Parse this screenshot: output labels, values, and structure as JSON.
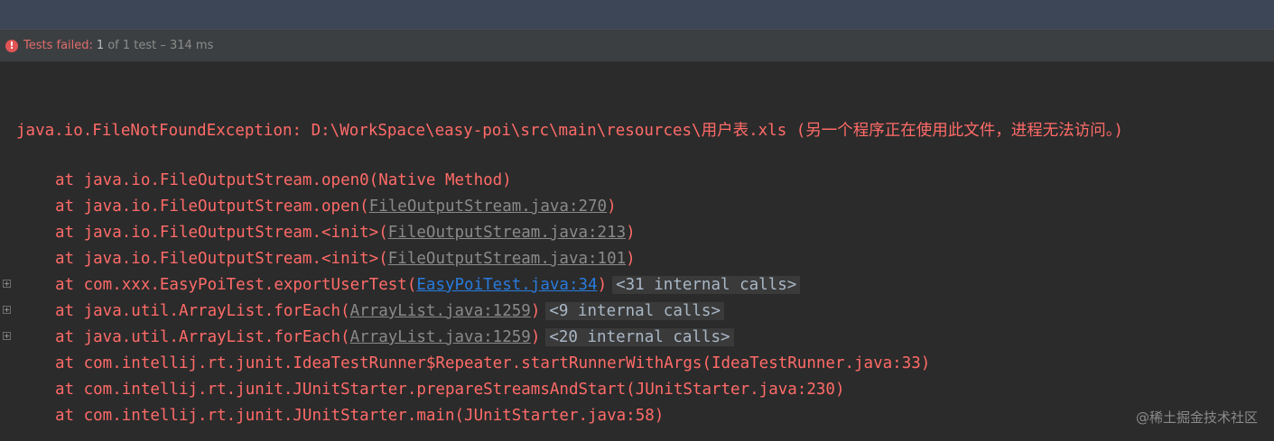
{
  "status": {
    "failed_label": "Tests failed:",
    "count": "1",
    "rest": "of 1 test – 314 ms"
  },
  "console": {
    "exception": "java.io.FileNotFoundException: D:\\WorkSpace\\easy-poi\\src\\main\\resources\\用户表.xls (另一个程序正在使用此文件，进程无法访问。)",
    "trace": [
      {
        "prefix": "at java.io.FileOutputStream.open0(Native Method)",
        "link": "",
        "suffix": "",
        "internal": ""
      },
      {
        "prefix": "at java.io.FileOutputStream.open(",
        "link": "FileOutputStream.java:270",
        "suffix": ")",
        "internal": ""
      },
      {
        "prefix": "at java.io.FileOutputStream.<init>(",
        "link": "FileOutputStream.java:213",
        "suffix": ")",
        "internal": ""
      },
      {
        "prefix": "at java.io.FileOutputStream.<init>(",
        "link": "FileOutputStream.java:101",
        "suffix": ")",
        "internal": ""
      },
      {
        "prefix": "at com.xxx.EasyPoiTest.exportUserTest(",
        "link": "EasyPoiTest.java:34",
        "suffix": ")",
        "internal": "<31 internal calls>"
      },
      {
        "prefix": "at java.util.ArrayList.forEach(",
        "link": "ArrayList.java:1259",
        "suffix": ")",
        "internal": "<9 internal calls>"
      },
      {
        "prefix": "at java.util.ArrayList.forEach(",
        "link": "ArrayList.java:1259",
        "suffix": ")",
        "internal": "<20 internal calls>"
      },
      {
        "prefix": "at com.intellij.rt.junit.IdeaTestRunner$Repeater.startRunnerWithArgs(IdeaTestRunner.java:33)",
        "link": "",
        "suffix": "",
        "internal": ""
      },
      {
        "prefix": "at com.intellij.rt.junit.JUnitStarter.prepareStreamsAndStart(JUnitStarter.java:230)",
        "link": "",
        "suffix": "",
        "internal": ""
      },
      {
        "prefix": "at com.intellij.rt.junit.JUnitStarter.main(JUnitStarter.java:58)",
        "link": "",
        "suffix": "",
        "internal": ""
      }
    ]
  },
  "watermark": "@稀土掘金技术社区",
  "colors": {
    "error_text": "#ff6b68",
    "link_blue": "#287bde",
    "link_gray": "#8a8a8a",
    "background": "#2b2b2b"
  },
  "icons": {
    "status": "error-circle-icon",
    "fold": "expand-plus-icon"
  }
}
